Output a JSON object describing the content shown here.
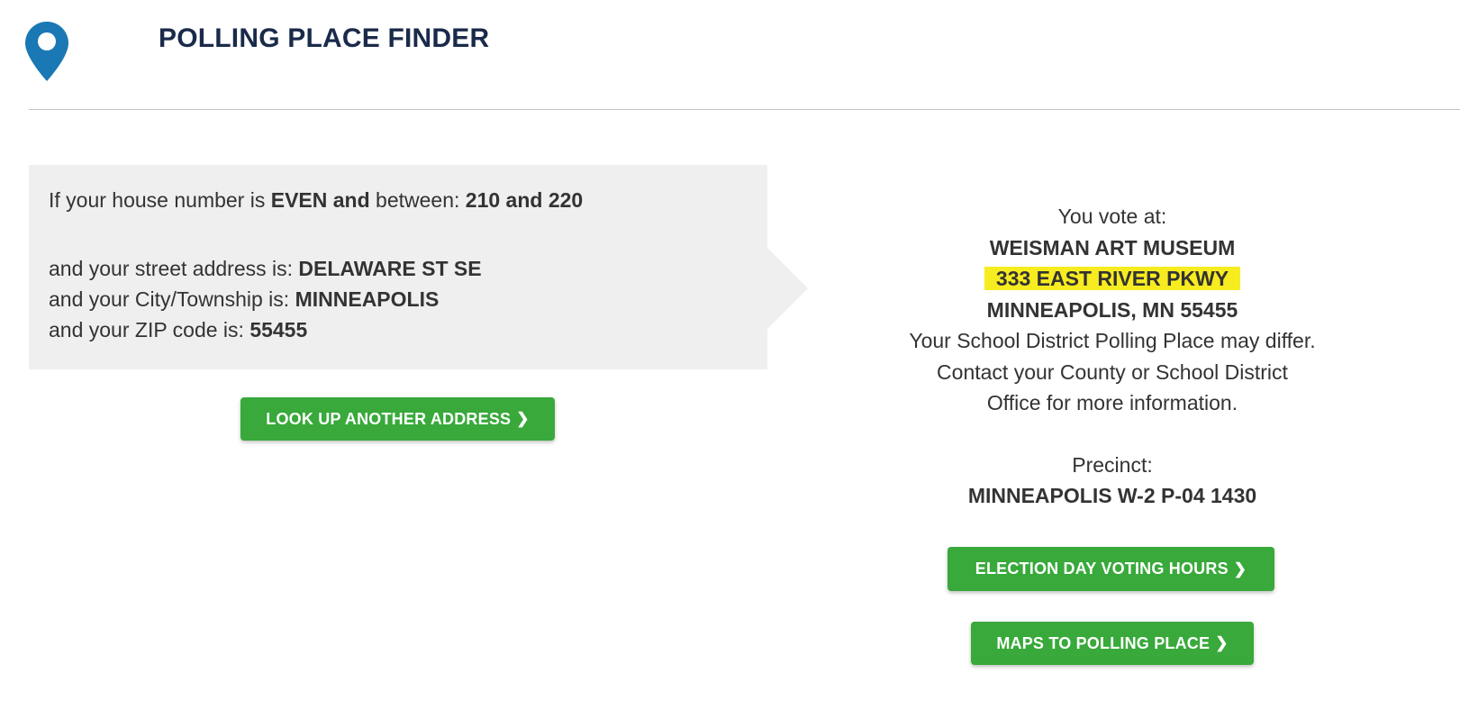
{
  "header": {
    "title": "POLLING PLACE FINDER",
    "icon": "map-pin-icon",
    "icon_color": "#1a78b4"
  },
  "criteria": {
    "line1_prefix": "If your house number is ",
    "parity": "EVEN and",
    "between_label": " between: ",
    "range": "210 and 220",
    "street_label": "and your street address is: ",
    "street": "DELAWARE ST SE",
    "city_label": "and your City/Township is: ",
    "city": "MINNEAPOLIS",
    "zip_label": "and your ZIP code is: ",
    "zip": "55455"
  },
  "result": {
    "vote_at_label": "You vote at:",
    "place_name": "WEISMAN ART MUSEUM",
    "address": "333 EAST RIVER PKWY",
    "city_state_zip": "MINNEAPOLIS, MN 55455",
    "note_line1": "Your School District Polling Place may differ.",
    "note_line2": "Contact your County or School District",
    "note_line3": "Office for more information.",
    "precinct_label": "Precinct:",
    "precinct": "MINNEAPOLIS W-2 P-04 1430"
  },
  "buttons": {
    "lookup": "LOOK UP ANOTHER ADDRESS",
    "hours": "ELECTION DAY VOTING HOURS",
    "maps": "MAPS TO POLLING PLACE",
    "chevron": "chevron-right-icon"
  },
  "colors": {
    "button_green": "#38a93a",
    "highlight_yellow": "#f7ec1f",
    "title_navy": "#1a2a4a"
  }
}
